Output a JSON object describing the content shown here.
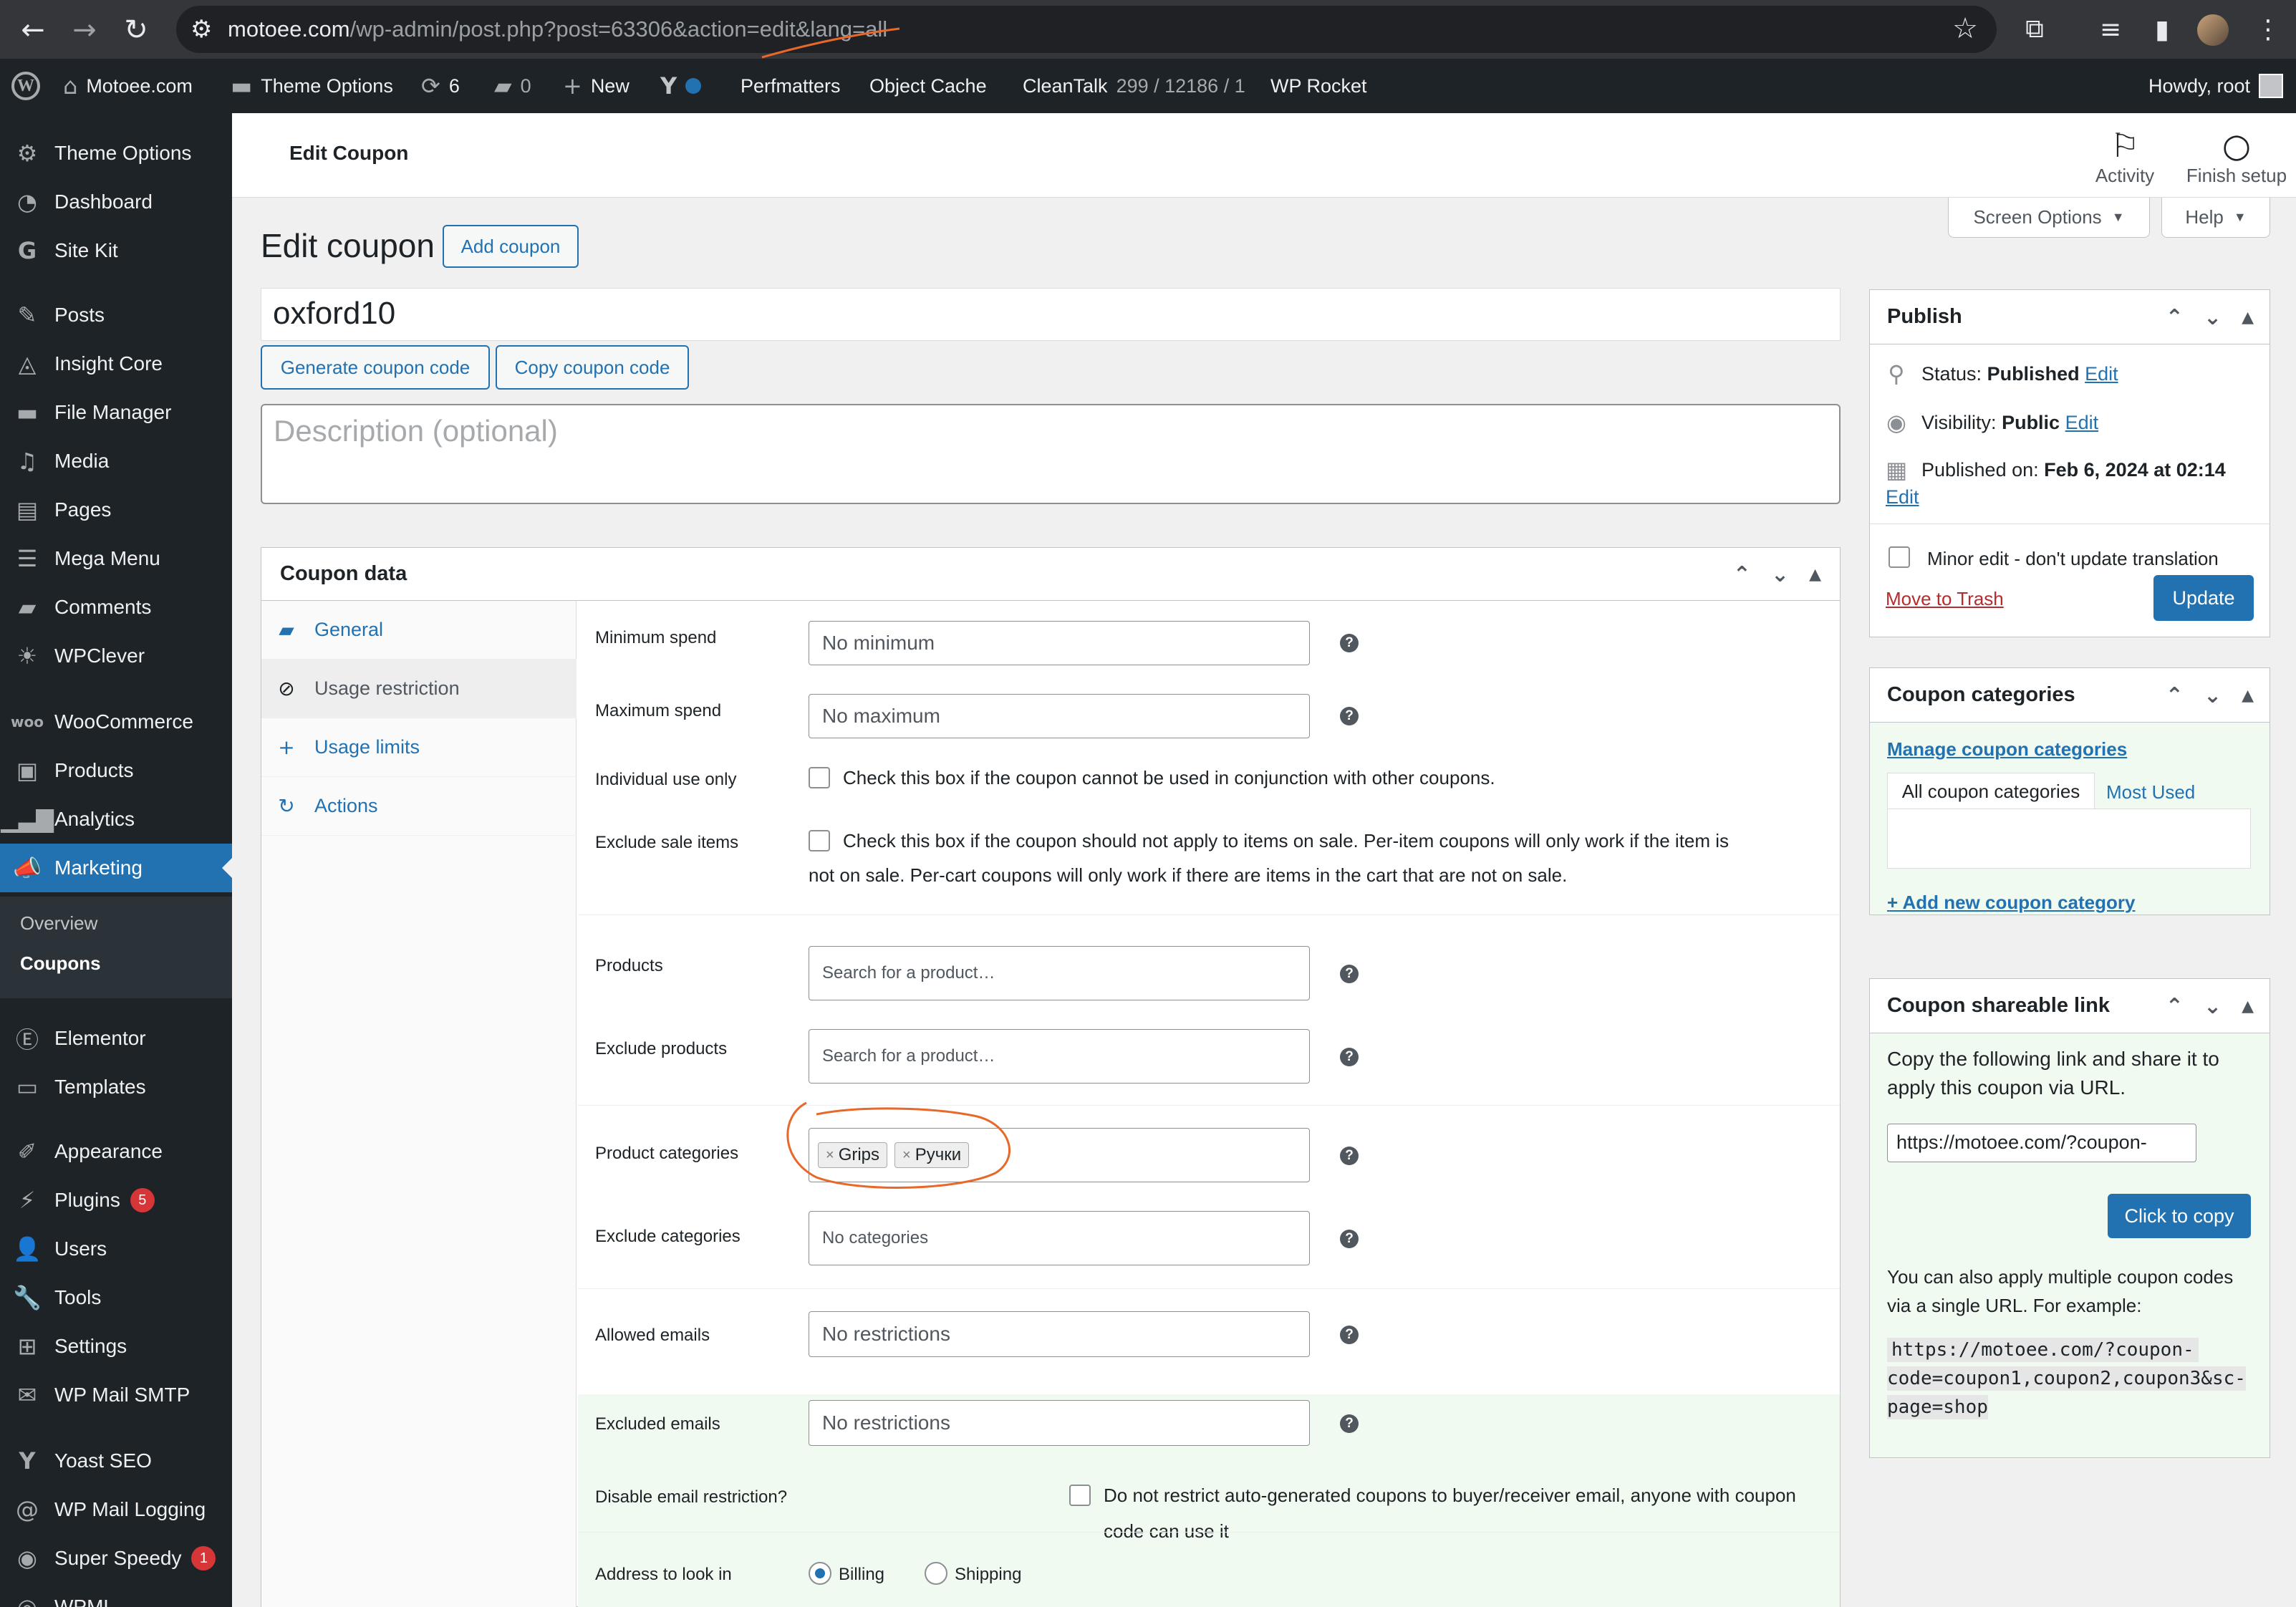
{
  "browser": {
    "url_host": "motoee.com",
    "url_path": "/wp-admin/post.php?post=63306&action=edit&lang=all"
  },
  "adminbar": {
    "site": "Motoee.com",
    "theme_options": "Theme Options",
    "updates": "6",
    "comments": "0",
    "new": "New",
    "perfmatters": "Perfmatters",
    "object_cache": "Object Cache",
    "cleantalk": "CleanTalk",
    "cleantalk_stats": "299 / 12186 / 1",
    "wp_rocket": "WP Rocket",
    "howdy": "Howdy, root"
  },
  "sidebar": {
    "items": [
      {
        "label": "Theme Options",
        "icon": "gear-icon"
      },
      {
        "label": "Dashboard",
        "icon": "dashboard-icon"
      },
      {
        "label": "Site Kit",
        "icon": "google-icon"
      },
      {
        "label": "Posts",
        "icon": "pin-icon"
      },
      {
        "label": "Insight Core",
        "icon": "insight-icon"
      },
      {
        "label": "File Manager",
        "icon": "folder-icon"
      },
      {
        "label": "Media",
        "icon": "media-icon"
      },
      {
        "label": "Pages",
        "icon": "pages-icon"
      },
      {
        "label": "Mega Menu",
        "icon": "menu-icon"
      },
      {
        "label": "Comments",
        "icon": "comment-icon"
      },
      {
        "label": "WPClever",
        "icon": "lightbulb-icon"
      },
      {
        "label": "WooCommerce",
        "icon": "woo-icon"
      },
      {
        "label": "Products",
        "icon": "archive-icon"
      },
      {
        "label": "Analytics",
        "icon": "bar-chart-icon"
      },
      {
        "label": "Marketing",
        "icon": "megaphone-icon"
      },
      {
        "label": "Elementor",
        "icon": "elementor-icon"
      },
      {
        "label": "Templates",
        "icon": "folder-open-icon"
      },
      {
        "label": "Appearance",
        "icon": "brush-icon"
      },
      {
        "label": "Plugins",
        "icon": "plug-icon",
        "badge": "5"
      },
      {
        "label": "Users",
        "icon": "user-icon"
      },
      {
        "label": "Tools",
        "icon": "wrench-icon"
      },
      {
        "label": "Settings",
        "icon": "sliders-icon"
      },
      {
        "label": "WP Mail SMTP",
        "icon": "mail-icon"
      },
      {
        "label": "Yoast SEO",
        "icon": "yoast-icon"
      },
      {
        "label": "WP Mail Logging",
        "icon": "at-icon"
      },
      {
        "label": "Super Speedy",
        "icon": "speed-icon",
        "badge": "1"
      },
      {
        "label": "WPML",
        "icon": "wpml-icon"
      }
    ],
    "submenu": [
      "Overview",
      "Coupons"
    ]
  },
  "header": {
    "title": "Edit Coupon",
    "activity": "Activity",
    "finish_setup": "Finish setup",
    "screen_options": "Screen Options",
    "help": "Help"
  },
  "page": {
    "h1": "Edit coupon",
    "add_coupon": "Add coupon",
    "coupon_code": "oxford10",
    "generate_code": "Generate coupon code",
    "copy_code": "Copy coupon code",
    "description_placeholder": "Description (optional)"
  },
  "coupon_data": {
    "title": "Coupon data",
    "tabs": [
      "General",
      "Usage restriction",
      "Usage limits",
      "Actions"
    ],
    "fields": {
      "min_spend_label": "Minimum spend",
      "min_spend_placeholder": "No minimum",
      "max_spend_label": "Maximum spend",
      "max_spend_placeholder": "No maximum",
      "individual_label": "Individual use only",
      "individual_text": "Check this box if the coupon cannot be used in conjunction with other coupons.",
      "exclude_sale_label": "Exclude sale items",
      "exclude_sale_text_1": "Check this box if the coupon should not apply to items on sale. Per-item coupons will only work if the item is",
      "exclude_sale_text_2": "not on sale. Per-cart coupons will only work if there are items in the cart that are not on sale.",
      "products_label": "Products",
      "products_placeholder": "Search for a product…",
      "exclude_products_label": "Exclude products",
      "exclude_products_placeholder": "Search for a product…",
      "product_categories_label": "Product categories",
      "product_categories": [
        "Grips",
        "Ручки"
      ],
      "exclude_categories_label": "Exclude categories",
      "exclude_categories_placeholder": "No categories",
      "allowed_emails_label": "Allowed emails",
      "allowed_emails_placeholder": "No restrictions",
      "excluded_emails_label": "Excluded emails",
      "excluded_emails_placeholder": "No restrictions",
      "disable_email_label": "Disable email restriction?",
      "disable_email_text": "Do not restrict auto-generated coupons to buyer/receiver email, anyone with coupon code can use it",
      "address_label": "Address to look in",
      "address_billing": "Billing",
      "address_shipping": "Shipping",
      "address_selected": "Billing"
    }
  },
  "publish": {
    "title": "Publish",
    "status_label": "Status:",
    "status_value": "Published",
    "visibility_label": "Visibility:",
    "visibility_value": "Public",
    "published_label": "Published on:",
    "published_value": "Feb 6, 2024 at 02:14",
    "edit": "Edit",
    "minor_edit": "Minor edit - don't update translation",
    "trash": "Move to Trash",
    "update": "Update"
  },
  "categories": {
    "title": "Coupon categories",
    "manage": "Manage coupon categories",
    "tab_all": "All coupon categories",
    "tab_most": "Most Used",
    "add_new": "+ Add new coupon category"
  },
  "shareable": {
    "title": "Coupon shareable link",
    "intro": "Copy the following link and share it to apply this coupon via URL.",
    "link": "https://motoee.com/?coupon-",
    "copy_button": "Click to copy",
    "multi_text": "You can also apply multiple coupon codes via a single URL. For example:",
    "example_1": "https://motoee.com/?coupon-",
    "example_2": "code=coupon1,coupon2,coupon3&sc-",
    "example_3": "page=shop"
  },
  "colors": {
    "accent": "#2271b1",
    "admin_dark": "#1d2327",
    "annotation": "#e8682a",
    "highlight_green": "#f0faf0"
  }
}
